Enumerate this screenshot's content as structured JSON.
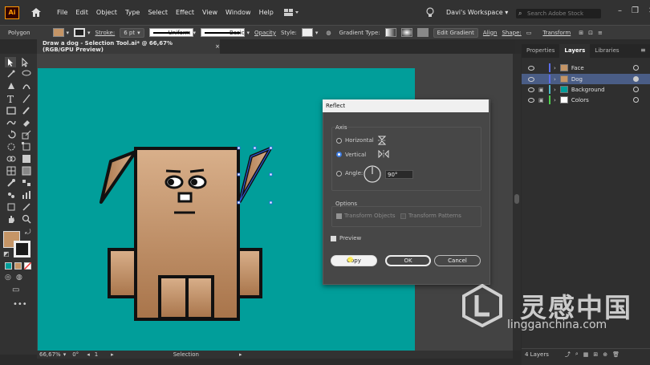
{
  "menubar": {
    "logo": "Ai",
    "items": [
      "File",
      "Edit",
      "Object",
      "Type",
      "Select",
      "Effect",
      "View",
      "Window",
      "Help"
    ],
    "workspace": "Davi's Workspace",
    "search_placeholder": "Search Adobe Stock"
  },
  "control_bar": {
    "object_type": "Polygon",
    "stroke_label": "Stroke:",
    "stroke_weight": "6 pt",
    "profile": "Uniform",
    "brush": "Basic",
    "opacity_label": "Opacity",
    "style_label": "Style:",
    "gradient_type_label": "Gradient Type:",
    "edit_gradient": "Edit Gradient",
    "align": "Align",
    "shape": "Shape:",
    "transform": "Transform"
  },
  "document": {
    "tab_title": "Draw a dog - Selection Tool.ai* @ 66,67% (RGB/GPU Preview)",
    "close": "×"
  },
  "status": {
    "zoom": "66,67%",
    "angle": "0°",
    "artboard": "1",
    "tool": "Selection"
  },
  "panel": {
    "tabs": [
      "Properties",
      "Layers",
      "Libraries"
    ],
    "active_tab": "Layers",
    "layers": [
      {
        "name": "Face",
        "color": "#5b6de8",
        "selected": false,
        "locked": false
      },
      {
        "name": "Dog",
        "color": "#5b6de8",
        "selected": true,
        "locked": false
      },
      {
        "name": "Background",
        "color": "#4fb8c8",
        "selected": false,
        "locked": true
      },
      {
        "name": "Colors",
        "color": "#4fd04f",
        "selected": false,
        "locked": true
      }
    ],
    "footer": "4 Layers"
  },
  "dialog": {
    "title": "Reflect",
    "axis_label": "Axis",
    "horizontal": "Horizontal",
    "vertical": "Vertical",
    "angle_label": "Angle:",
    "angle_value": "90°",
    "options_label": "Options",
    "transform_objects": "Transform Objects",
    "transform_patterns": "Transform Patterns",
    "preview": "Preview",
    "copy": "Copy",
    "ok": "OK",
    "cancel": "Cancel",
    "selected_axis": "Vertical",
    "preview_checked": true
  },
  "watermark": {
    "cn": "灵感中国",
    "en": "lingganchina.com"
  },
  "colors": {
    "artboard": "#019e9a",
    "dog_light": "#d6ab85",
    "dog_dark": "#a06b40",
    "selection": "#2e5fe8"
  }
}
